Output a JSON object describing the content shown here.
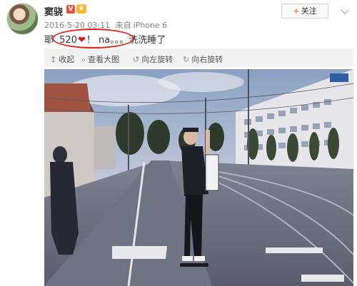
{
  "user": {
    "name": "窦骁",
    "badges": [
      "vip-badge",
      "crown-badge"
    ]
  },
  "meta": {
    "date": "2016-5-20 03:11",
    "source_prefix": "来自",
    "source": "iPhone 6"
  },
  "header": {
    "follow_label": "关注",
    "follow_plus": "+"
  },
  "post": {
    "text_before": "耶",
    "highlight_number": "520",
    "heart": "❤",
    "text_after": "！ na。。。洗洗睡了"
  },
  "toolbar": {
    "collapse_label": "收起",
    "view_large_label": "查看大图",
    "rotate_left_label": "向左旋转",
    "rotate_right_label": "向右旋转"
  },
  "colors": {
    "accent_orange": "#fa7d3c",
    "annotation_red": "#e62117",
    "heart_red": "#d81e1e",
    "meta_gray": "#808080"
  }
}
